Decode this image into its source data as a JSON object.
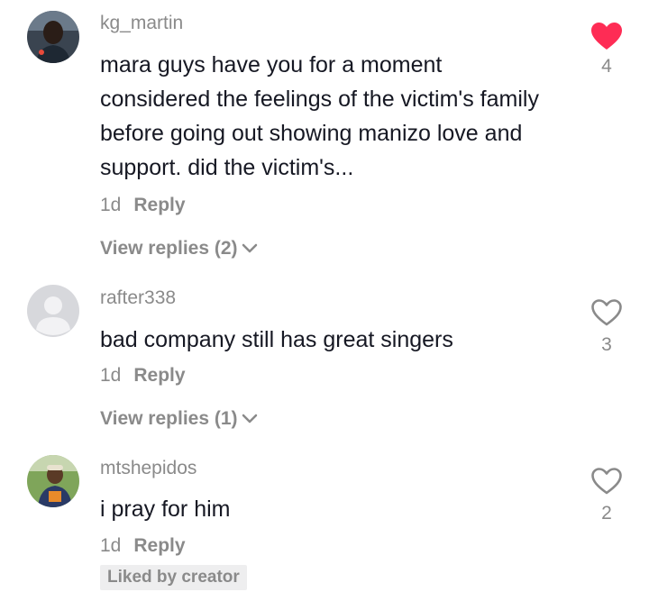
{
  "comments": [
    {
      "username": "kg_martin",
      "text": "mara guys have you for a moment considered the feelings of the victim's family before going out showing manizo love and support. did the victim's...",
      "time": "1d",
      "reply_label": "Reply",
      "view_replies": "View replies (2)",
      "likes": "4",
      "liked": true
    },
    {
      "username": "rafter338",
      "text": "bad company still has great singers",
      "time": "1d",
      "reply_label": "Reply",
      "view_replies": "View replies (1)",
      "likes": "3",
      "liked": false
    },
    {
      "username": "mtshepidos",
      "text": "i pray for him",
      "time": "1d",
      "reply_label": "Reply",
      "badge": "Liked by creator",
      "likes": "2",
      "liked": false
    }
  ],
  "icons": {
    "liked_heart": "heart-filled-icon",
    "heart": "heart-outline-icon",
    "chevron": "chevron-down-icon"
  },
  "colors": {
    "liked": "#fe2c55",
    "secondary_text": "#8a8a8a",
    "primary_text": "#161823"
  }
}
